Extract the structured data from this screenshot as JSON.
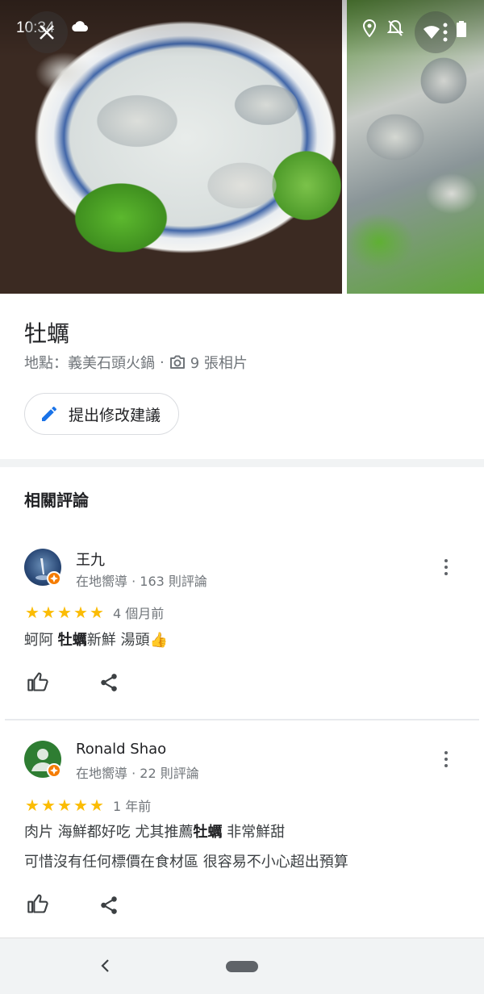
{
  "status_bar": {
    "time": "10:34",
    "icons": [
      "cloud-icon",
      "location-icon",
      "notifications-off-icon",
      "wifi-icon",
      "signal-icon",
      "battery-icon"
    ]
  },
  "photos": [
    "oyster-photo-1",
    "oyster-photo-2"
  ],
  "dish": {
    "title": "牡蠣",
    "location": "地點：義美石頭火鍋",
    "separator": "·",
    "photo_count": "9 張相片"
  },
  "suggest_edit_label": "提出修改建議",
  "related_reviews_title": "相關評論",
  "reviews": [
    {
      "author": "王九",
      "meta": "在地嚮導 · 163 則評論",
      "rating": 5,
      "stars": "★★★★★",
      "date": "4 個月前",
      "text_lines": [
        {
          "before": "蚵阿 ",
          "highlight": "牡蠣",
          "after": "新鮮  湯頭👍"
        }
      ]
    },
    {
      "author": "Ronald Shao",
      "meta": "在地嚮導 · 22 則評論",
      "rating": 5,
      "stars": "★★★★★",
      "date": "1 年前",
      "text_lines": [
        {
          "before": "肉片 海鮮都好吃 尤其推薦",
          "highlight": "牡蠣",
          "after": " 非常鮮甜"
        },
        {
          "before": "可惜沒有任何標價在食材區 很容易不小心超出預算",
          "highlight": "",
          "after": ""
        }
      ]
    }
  ],
  "colors": {
    "star": "#fbbc04",
    "accent": "#1a73e8",
    "badge": "#f57c00",
    "avatar_2": "#2e7d32"
  }
}
